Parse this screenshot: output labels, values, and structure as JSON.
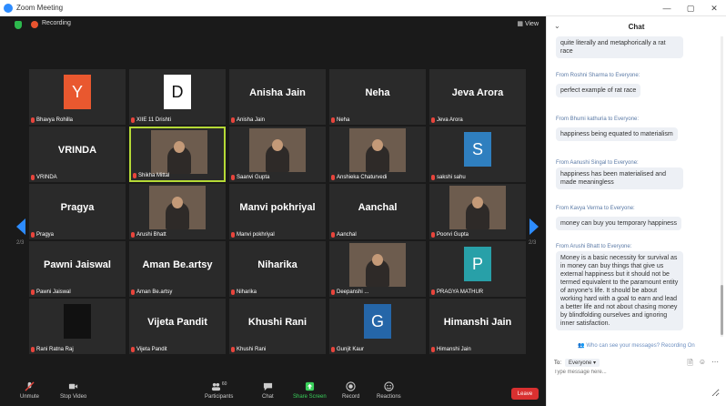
{
  "window": {
    "title": "Zoom Meeting",
    "minimize": "—",
    "maximize": "▢",
    "close": "✕"
  },
  "topbar": {
    "recording": "Recording",
    "view": "View"
  },
  "pages": {
    "left": "2/3",
    "right": "2/3"
  },
  "tiles": [
    {
      "big": "",
      "label": "Bhavya Rohilla",
      "avatar": "Y",
      "color": "#e9582f"
    },
    {
      "big": "",
      "label": "XIIE 11 Drishti",
      "avatar": "D",
      "color": "#ffffff",
      "avatar_text_color": "#111111"
    },
    {
      "big": "Anisha Jain",
      "label": "Anisha Jain"
    },
    {
      "big": "Neha",
      "label": "Neha"
    },
    {
      "big": "Jeva Arora",
      "label": "Jeva Arora"
    },
    {
      "big": "VRINDA",
      "label": "VRINDA"
    },
    {
      "big": "",
      "label": "Shikha Mittal",
      "video": true
    },
    {
      "big": "",
      "label": "Saanvi Gupta",
      "video": true
    },
    {
      "big": "",
      "label": "Anshieka Chaturvedi",
      "video": true
    },
    {
      "big": "",
      "label": "sakshi sahu",
      "avatar": "S",
      "color": "#2f7fbf"
    },
    {
      "big": "Pragya",
      "label": "Pragya"
    },
    {
      "big": "",
      "label": "Arushi Bhatt",
      "video": true
    },
    {
      "big": "Manvi pokhriyal",
      "label": "Manvi pokhriyal"
    },
    {
      "big": "Aanchal",
      "label": "Aanchal"
    },
    {
      "big": "",
      "label": "Poorvi Gupta",
      "video": true
    },
    {
      "big": "Pawni Jaiswal",
      "label": "Pawni Jaiswal"
    },
    {
      "big": "Aman Be.artsy",
      "label": "Aman Be.artsy"
    },
    {
      "big": "Niharika",
      "label": "Niharika"
    },
    {
      "big": "",
      "label": "Deepanshi ...",
      "video": true
    },
    {
      "big": "",
      "label": "PRAGYA MATHUR",
      "avatar": "P",
      "color": "#28a0a8"
    },
    {
      "big": "",
      "label": "Rani Ratna Raj",
      "avatar": "",
      "color": "#111111"
    },
    {
      "big": "Vijeta Pandit",
      "label": "Vijeta Pandit"
    },
    {
      "big": "Khushi Rani",
      "label": "Khushi Rani"
    },
    {
      "big": "",
      "label": "Gunjit Kaur",
      "avatar": "G",
      "color": "#2566a8"
    },
    {
      "big": "Himanshi Jain",
      "label": "Himanshi Jain"
    }
  ],
  "toolbar": {
    "unmute": "Unmute",
    "stop_video": "Stop Video",
    "participants": "Participants",
    "participants_count": "60",
    "chat": "Chat",
    "share": "Share Screen",
    "record": "Record",
    "reactions": "Reactions",
    "leave": "Leave"
  },
  "chat": {
    "title": "Chat",
    "messages": [
      {
        "from": "",
        "text": "quite literally and metaphorically a rat race"
      },
      {
        "from": "From Roshni Sharma to Everyone:",
        "text": "perfect example of rat race"
      },
      {
        "from": "From Bhumi kathuria to Everyone:",
        "text": "happiness being equated to materialism"
      },
      {
        "from": "From Aanushi Singal to Everyone:",
        "text": "happiness has been materialised and made meaningless"
      },
      {
        "from": "From Kavya Verma to Everyone:",
        "text": "money can buy you temporary happiness"
      },
      {
        "from": "From Arushi Bhatt to Everyone:",
        "text": "Money is a basic necessity for survival as in money can buy things that give us external happiness but it should not be termed equivalent to the paramount entity of anyone's life. It should be about working hard with a goal to earn and lead a better life and not about chasing money by blindfolding ourselves and ignoring inner satisfaction."
      }
    ],
    "privacy": "Who can see your messages? Recording On",
    "to_label": "To:",
    "to_value": "Everyone",
    "input_placeholder": "Type message here..."
  }
}
